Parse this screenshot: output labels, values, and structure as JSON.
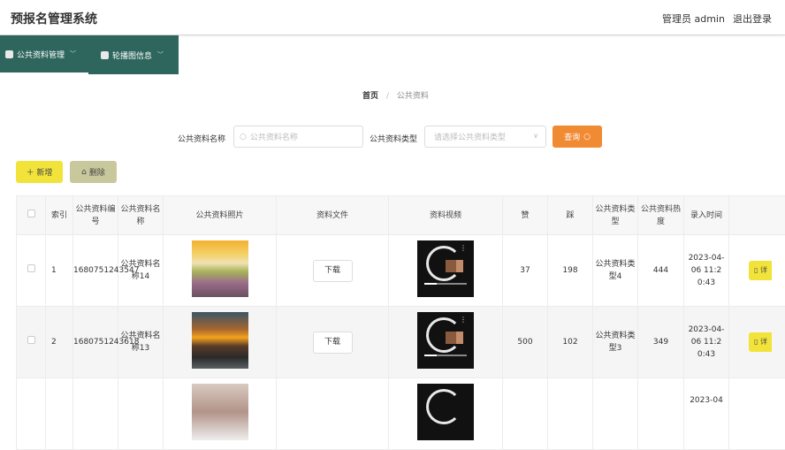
{
  "header": {
    "title": "预报名管理系统",
    "user_label": "管理员 admin",
    "logout_label": "退出登录"
  },
  "nav": {
    "items": [
      {
        "label": "公共资料管理",
        "icon": "person-icon"
      },
      {
        "label": "轮播图信息",
        "icon": "briefcase-icon"
      }
    ]
  },
  "breadcrumb": {
    "home": "首页",
    "separator": "/",
    "current": "公共资料"
  },
  "search": {
    "name_label": "公共资料名称",
    "name_placeholder": "公共资料名称",
    "type_label": "公共资料类型",
    "type_placeholder": "请选择公共资料类型",
    "query_label": "查询"
  },
  "actions": {
    "add_label": "＋ 新增",
    "delete_label": "删除"
  },
  "table": {
    "headers": {
      "index": "索引",
      "code": "公共资料编号",
      "name": "公共资料名称",
      "photo": "公共资料照片",
      "file": "资料文件",
      "video": "资料视频",
      "likes": "赞",
      "dislikes": "踩",
      "type": "公共资料类型",
      "heat": "公共资料热度",
      "time": "录入时间"
    },
    "download_label": "下载",
    "op_label": "详",
    "rows": [
      {
        "index": "1",
        "code": "1680751243547",
        "name": "公共资料名称14",
        "likes": "37",
        "dislikes": "198",
        "type": "公共资料类型4",
        "heat": "444",
        "time": "2023-04-06 11:20:43"
      },
      {
        "index": "2",
        "code": "1680751243618",
        "name": "公共资料名称13",
        "likes": "500",
        "dislikes": "102",
        "type": "公共资料类型3",
        "heat": "349",
        "time": "2023-04-06 11:20:43"
      },
      {
        "index": "",
        "code": "",
        "name": "",
        "likes": "",
        "dislikes": "",
        "type": "",
        "heat": "",
        "time": "2023-04"
      }
    ]
  },
  "colors": {
    "nav_bg": "#2e665d",
    "query_btn": "#f08a33",
    "add_btn": "#f2e33a",
    "delete_btn": "#c9c89c"
  }
}
